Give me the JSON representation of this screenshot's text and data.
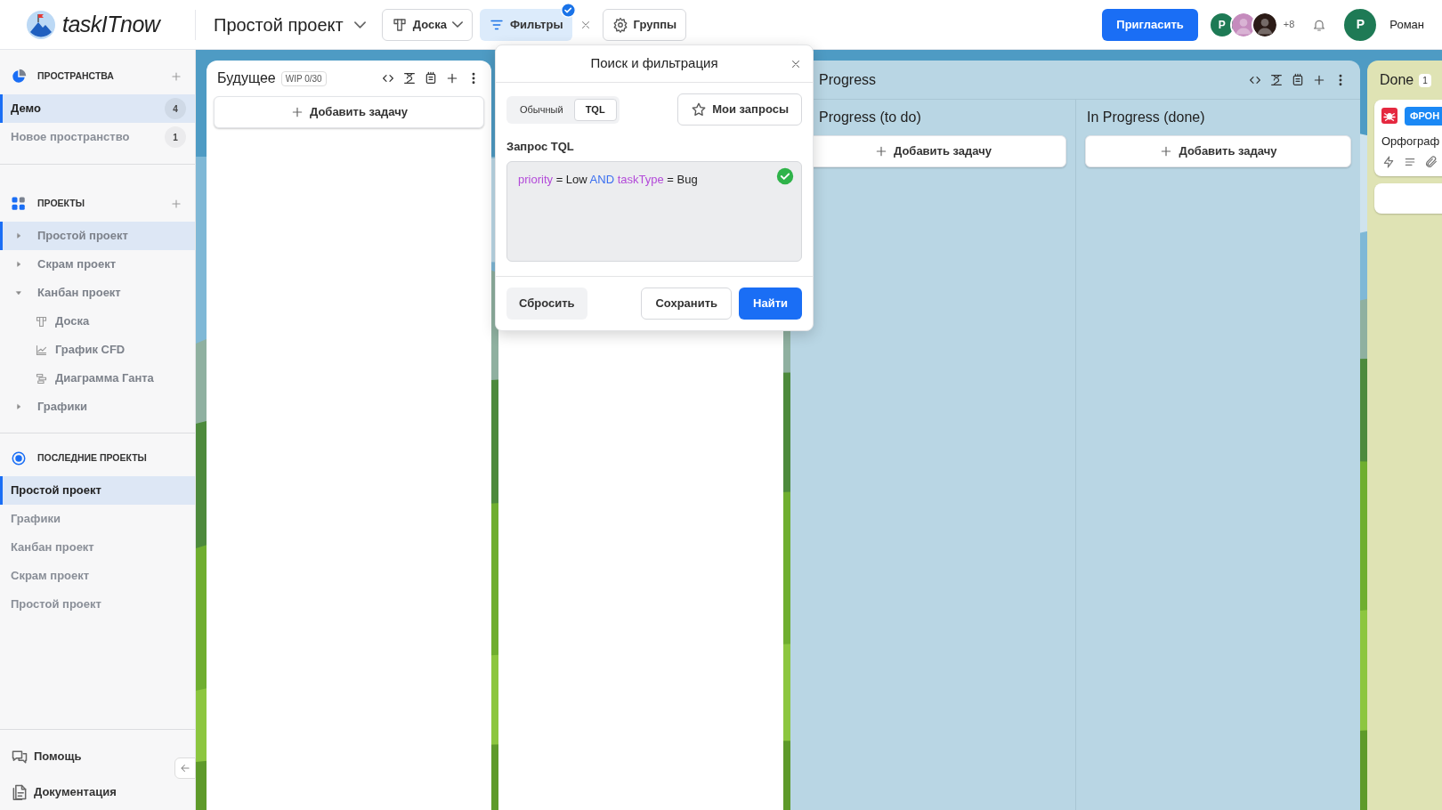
{
  "header": {
    "logo": "taskITnow",
    "project_title": "Простой проект",
    "view_button": "Доска",
    "filter_button": {
      "label": "Фильтры",
      "active": true
    },
    "groups_button": "Группы",
    "invite_button": "Пригласить",
    "avatars": [
      {
        "kind": "initial",
        "text": "Р",
        "color": "#1e7a55"
      },
      {
        "kind": "picture",
        "color": "#c58bbd"
      },
      {
        "kind": "picture",
        "color": "#2b1b16"
      }
    ],
    "more_count": "+8",
    "user": {
      "initial": "Р",
      "name": "Роман"
    }
  },
  "sidebar": {
    "spaces": {
      "title": "ПРОСТРАНСТВА",
      "items": [
        {
          "label": "Демо",
          "count": "4",
          "selected": true
        },
        {
          "label": "Новое пространство",
          "count": "1",
          "selected": false
        }
      ]
    },
    "projects": {
      "title": "ПРОЕКТЫ",
      "items": [
        {
          "label": "Простой проект",
          "selected": true,
          "expanded": false
        },
        {
          "label": "Скрам проект",
          "selected": false,
          "expanded": false
        },
        {
          "label": "Канбан проект",
          "selected": false,
          "expanded": true,
          "children": [
            {
              "label": "Доска",
              "kind": "board",
              "selected": false
            },
            {
              "label": "График CFD",
              "kind": "chart",
              "selected": false
            },
            {
              "label": "Диаграмма Ганта",
              "kind": "gantt",
              "selected": false
            }
          ]
        },
        {
          "label": "Графики",
          "selected": false,
          "expanded": false
        }
      ]
    },
    "recent": {
      "title": "ПОСЛЕДНИЕ ПРОЕКТЫ",
      "items": [
        {
          "label": "Простой проект",
          "selected": true
        },
        {
          "label": "Графики",
          "selected": false
        },
        {
          "label": "Канбан проект",
          "selected": false
        },
        {
          "label": "Скрам проект",
          "selected": false
        },
        {
          "label": "Простой проект",
          "selected": false
        }
      ]
    },
    "footer": [
      {
        "label": "Помощь",
        "kind": "help"
      },
      {
        "label": "Документация",
        "kind": "docs"
      }
    ]
  },
  "board": {
    "columns": [
      {
        "kind": "column",
        "title": "Будущее",
        "wip": "WIP 0/30",
        "add_label": "Добавить задачу"
      },
      {
        "kind": "column"
      },
      {
        "kind": "group",
        "title": "Progress",
        "subcolumns": [
          {
            "title": "Progress (to do)",
            "add_label": "Добавить задачу"
          },
          {
            "title": "In Progress (done)",
            "add_label": "Добавить задачу"
          }
        ]
      },
      {
        "kind": "done",
        "title": "Done",
        "count": "1",
        "cards": [
          {
            "kind": "task",
            "tag": "ФРОН",
            "text": "Орфограф"
          },
          {
            "kind": "blank"
          }
        ]
      }
    ]
  },
  "filter_popup": {
    "title": "Поиск и фильтрация",
    "modes": [
      {
        "label": "Обычный",
        "selected": false
      },
      {
        "label": "TQL",
        "selected": true
      }
    ],
    "saved_button": "Мои запросы",
    "query_label": "Запрос TQL",
    "query": [
      {
        "text": "priority",
        "kind": "field"
      },
      {
        "text": "= Low",
        "kind": "plain"
      },
      {
        "text": "AND",
        "kind": "keyword"
      },
      {
        "text": "taskType",
        "kind": "field"
      },
      {
        "text": "= Bug",
        "kind": "plain"
      }
    ],
    "valid": true,
    "reset_button": "Сбросить",
    "save_button": "Сохранить",
    "find_button": "Найти"
  }
}
